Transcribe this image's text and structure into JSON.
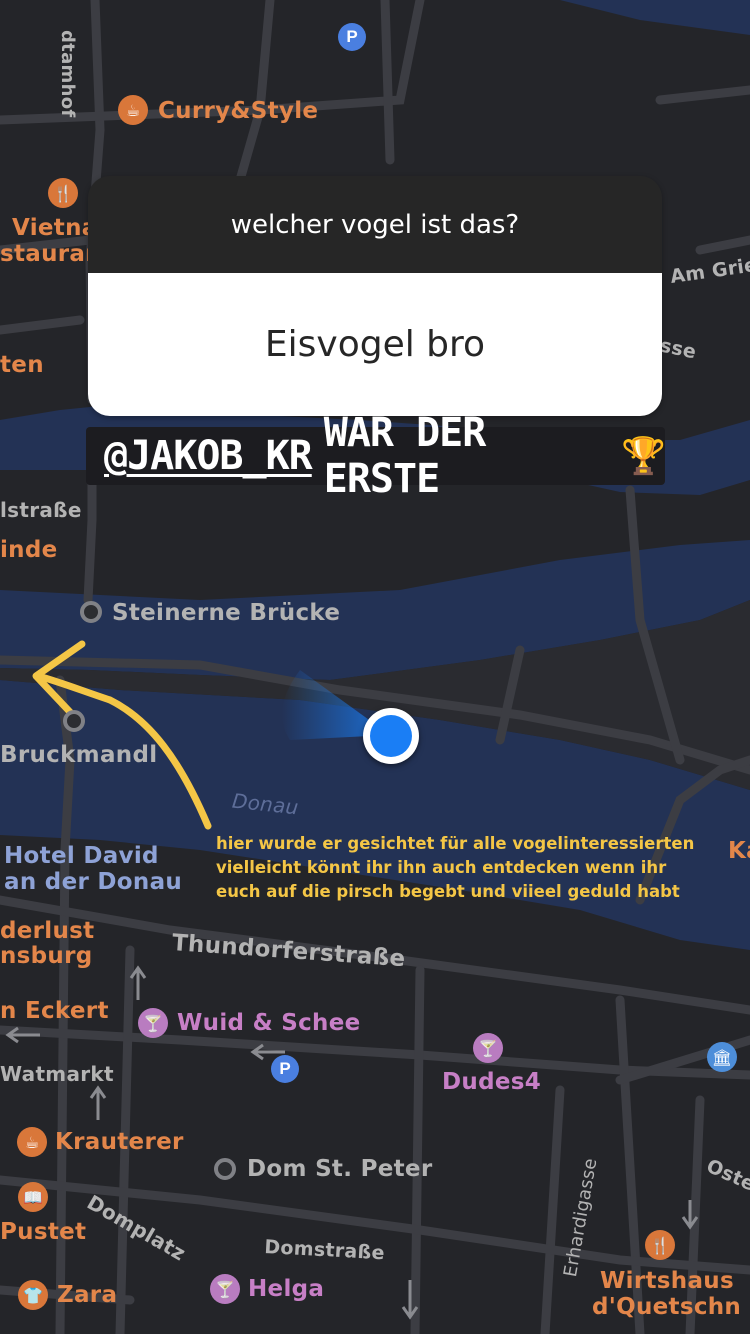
{
  "question_sticker": {
    "question": "welcher vogel ist das?",
    "answer": "Eisvogel bro"
  },
  "winner_banner": {
    "mention": "@JAKOB_KR",
    "text": "WAR DER ERSTE",
    "emoji": "🏆"
  },
  "caption": {
    "lines": [
      "hier wurde er gesichtet für alle vogelinteressierten",
      "vielleicht könnt ihr ihn auch entdecken wenn ihr",
      "euch auf die pirsch begebt und viieel geduld habt"
    ]
  },
  "map": {
    "colors": {
      "land": "#242529",
      "water": "#233255",
      "road": "#3c3d43",
      "location": "#1a7ef5",
      "arrow": "#f4c646"
    },
    "labels": {
      "dtamhof": "dtamhof",
      "curry_style": "Curry&Style",
      "vietna": "Vietna",
      "staurant": "staurant",
      "ten": "ten",
      "am_grie": "Am Grie",
      "sse": "sse",
      "lstrasse": "lstraße",
      "inde": "inde",
      "steinerne_bruecke": "Steinerne Brücke",
      "bruckmandl": "Bruckmandl",
      "donau": "Donau",
      "hotel_david_1": "Hotel David",
      "hotel_david_2": "an der Donau",
      "ka": "Ka",
      "derlust": "derlust",
      "nsburg": "nsburg",
      "thundorferstrasse": "Thundorferstraße",
      "n_eckert": "n Eckert",
      "wuid_schee": "Wuid & Schee",
      "dudes4": "Dudes4",
      "watmarkt": "Watmarkt",
      "krauterer": "Krauterer",
      "dom_st_peter": "Dom St. Peter",
      "domplatz": "Domplatz",
      "erhardigasse": "Erhardigasse",
      "ost": "Oste",
      "pustet": "Pustet",
      "domstrasse": "Domstraße",
      "zara": "Zara",
      "helga": "Helga",
      "wirtshaus_1": "Wirtshaus",
      "wirtshaus_2": "d'Quetschn"
    },
    "parking_symbol": "P"
  },
  "icons": [
    "restaurant-icon",
    "cafe-icon",
    "bar-icon",
    "parking-icon",
    "museum-icon",
    "book-icon",
    "shirt-icon",
    "station-icon",
    "location-dot-icon",
    "trophy-icon",
    "arrow-icon"
  ]
}
